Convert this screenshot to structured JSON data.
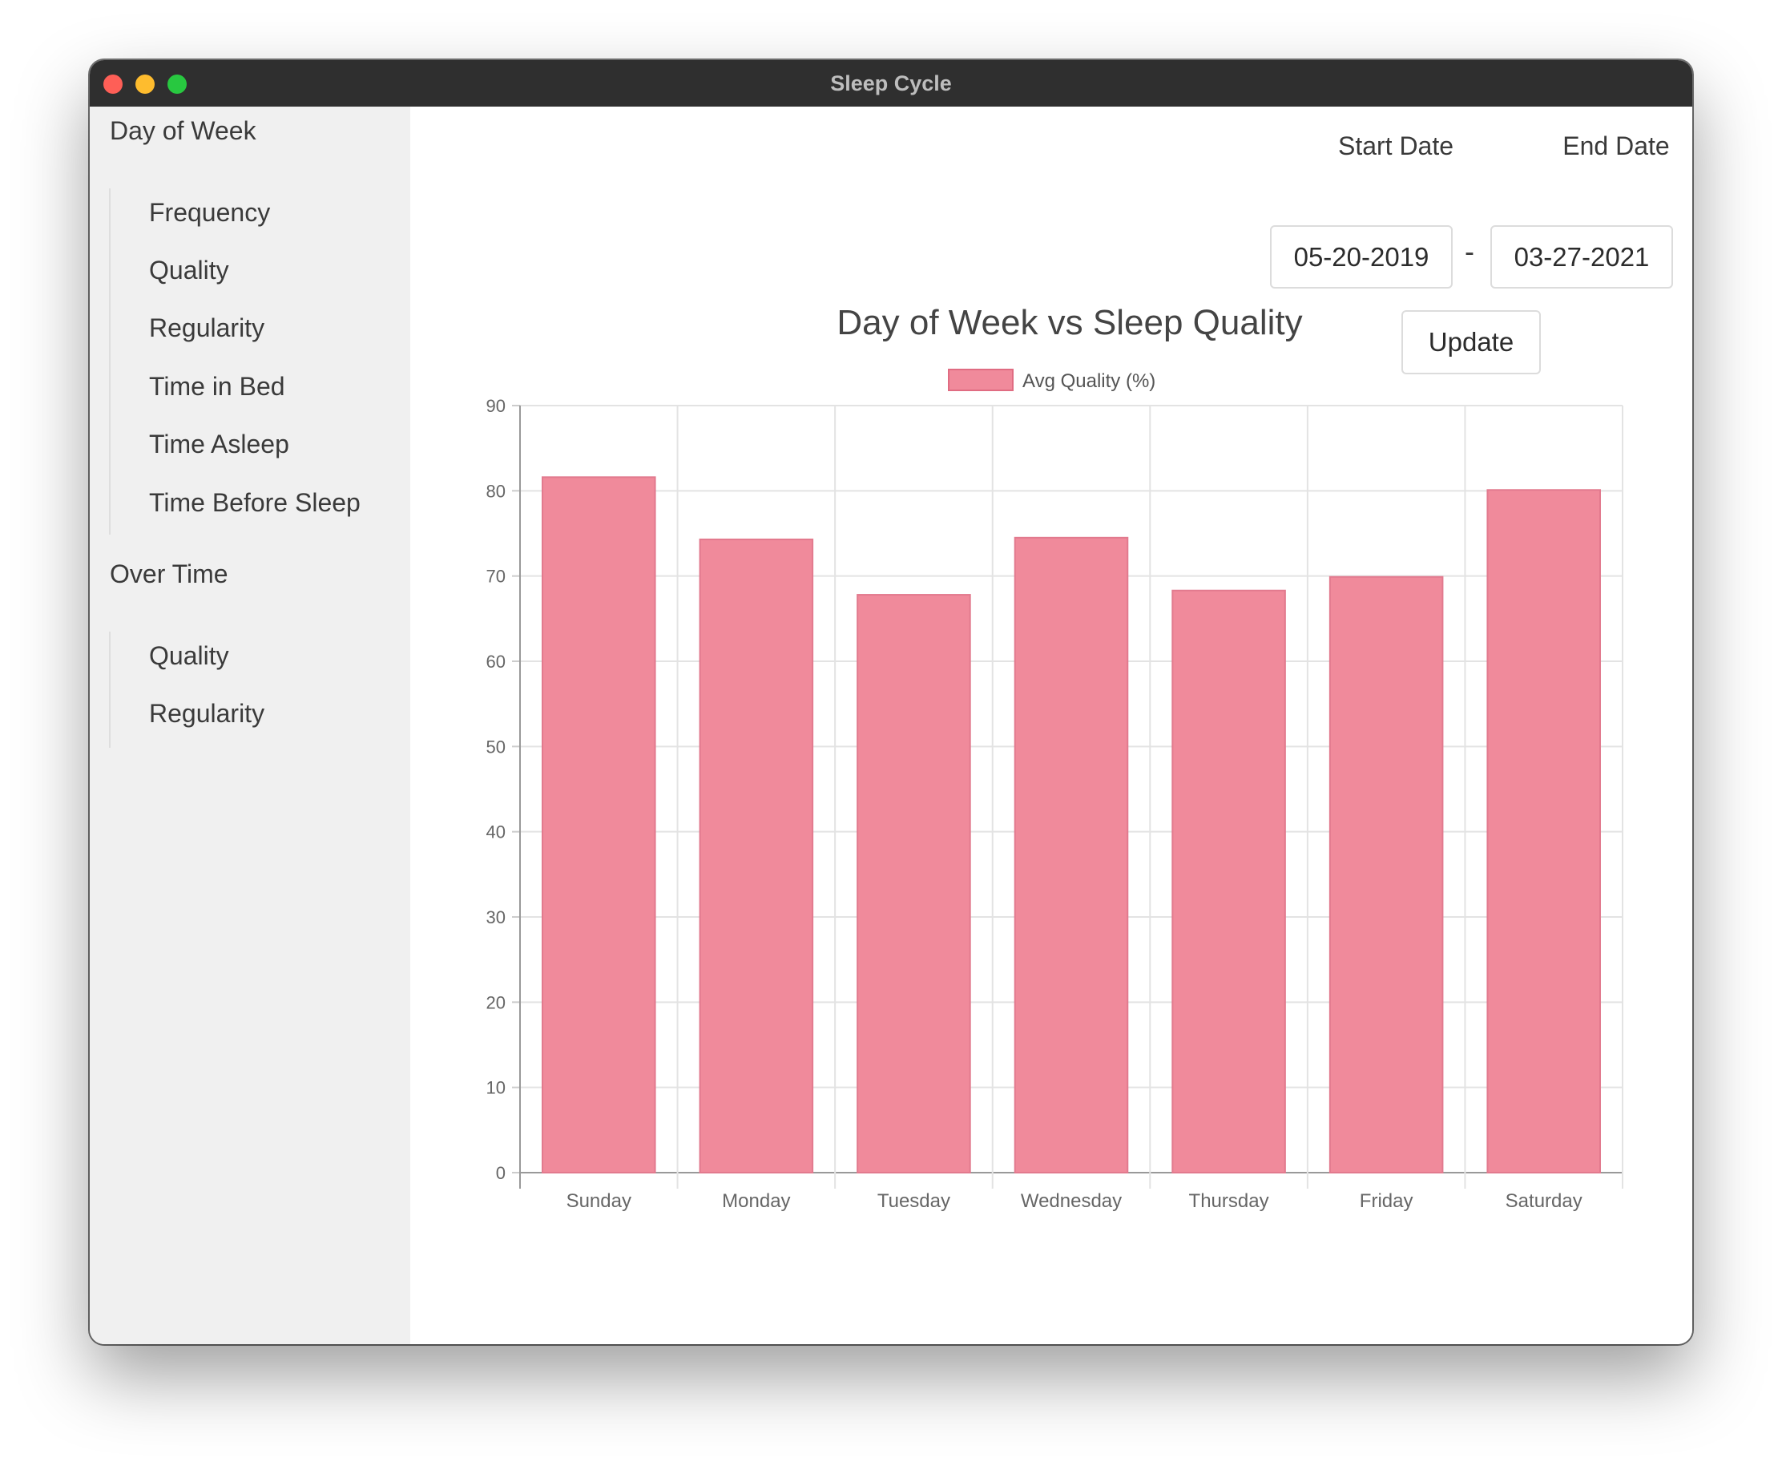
{
  "window": {
    "title": "Sleep Cycle"
  },
  "sidebar": {
    "sections": [
      {
        "heading": "Day of Week",
        "items": [
          "Frequency",
          "Quality",
          "Regularity",
          "Time in Bed",
          "Time Asleep",
          "Time Before Sleep"
        ]
      },
      {
        "heading": "Over Time",
        "items": [
          "Quality",
          "Regularity"
        ]
      }
    ]
  },
  "filters": {
    "start_label": "Start Date",
    "start_value": "05-20-2019",
    "separator": "-",
    "end_label": "End Date",
    "end_value": "03-27-2021",
    "update_label": "Update"
  },
  "chart_data": {
    "type": "bar",
    "title": "Day of Week vs Sleep Quality",
    "categories": [
      "Sunday",
      "Monday",
      "Tuesday",
      "Wednesday",
      "Thursday",
      "Friday",
      "Saturday"
    ],
    "series": [
      {
        "name": "Avg Quality (%)",
        "values": [
          81.6,
          74.3,
          67.8,
          74.5,
          68.3,
          69.9,
          80.1
        ],
        "color": "#f08a9b"
      }
    ],
    "ylim": [
      0,
      90
    ],
    "yticks": [
      0,
      10,
      20,
      30,
      40,
      50,
      60,
      70,
      80,
      90
    ],
    "grid": true,
    "legend": "top"
  }
}
